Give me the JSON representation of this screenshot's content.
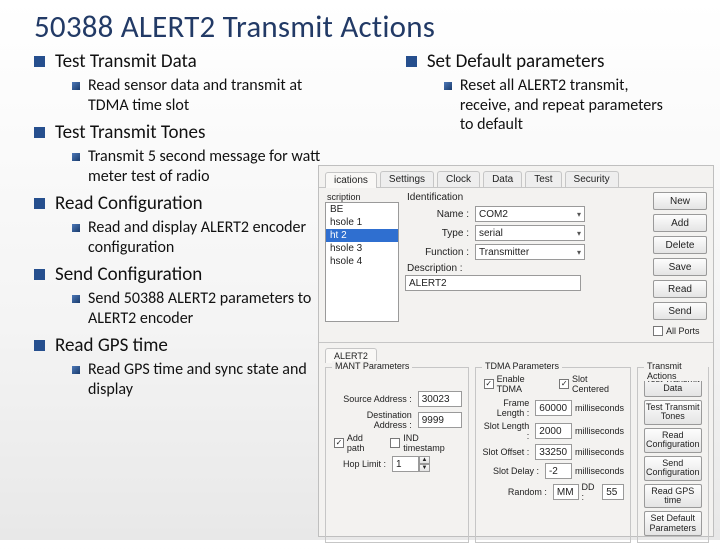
{
  "title": "50388 ALERT2 Transmit Actions",
  "left": [
    {
      "label": "Test Transmit Data",
      "sub": [
        "Read sensor data and transmit at TDMA time slot"
      ]
    },
    {
      "label": "Test Transmit Tones",
      "sub": [
        "Transmit 5 second message for watt meter test of radio"
      ]
    },
    {
      "label": "Read Configuration",
      "sub": [
        "Read and display ALERT2 encoder configuration"
      ]
    },
    {
      "label": "Send Configuration",
      "sub": [
        "Send 50388 ALERT2 parameters to ALERT2 encoder"
      ]
    },
    {
      "label": "Read GPS time",
      "sub": [
        "Read GPS time and sync state and display"
      ]
    }
  ],
  "right": [
    {
      "label": "Set Default parameters",
      "sub": [
        "Reset all ALERT2 transmit, receive, and repeat parameters to default"
      ]
    }
  ],
  "shot": {
    "tabs": [
      "ications",
      "Settings",
      "Clock",
      "Data",
      "Test",
      "Security"
    ],
    "active_tab": 0,
    "list_header": "scription",
    "list_items": [
      "BE",
      "hsole 1",
      "ht 2",
      "hsole 3",
      "hsole 4"
    ],
    "list_selected": 2,
    "id_group": "Identification",
    "form": {
      "name_label": "Name :",
      "name_value": "COM2",
      "type_label": "Type :",
      "type_value": "serial",
      "func_label": "Function :",
      "func_value": "Transmitter",
      "desc_label": "Description :",
      "desc_value": "ALERT2"
    },
    "buttons": [
      "New",
      "Add",
      "Delete",
      "Save",
      "Read",
      "Send"
    ],
    "allports_label": "All Ports",
    "lower_tab": "ALERT2",
    "g1": {
      "caption": "MANT Parameters",
      "src_label": "Source Address :",
      "src_value": "30023",
      "dst_label": "Destination Address :",
      "dst_value": "9999",
      "addpath_label": "Add path",
      "indts_label": "IND timestamp",
      "hop_label": "Hop Limit :",
      "hop_value": "1"
    },
    "g2": {
      "caption": "TDMA Parameters",
      "enable_label": "Enable TDMA",
      "centered_label": "Slot Centered",
      "frame_label": "Frame Length :",
      "frame_value": "60000",
      "slotlen_label": "Slot Length :",
      "slotlen_value": "2000",
      "slotoff_label": "Slot Offset :",
      "slotoff_value": "33250",
      "slotdly_label": "Slot Delay :",
      "slotdly_value": "-2",
      "rnd_label": "Random :",
      "rnd_value": "MM",
      "rnd_unit_label": "DD :",
      "rnd_unit_value": "55",
      "unit_ms": "milliseconds"
    },
    "g3": {
      "caption": "Transmit Actions",
      "buttons": [
        "Test Transmit Data",
        "Test Transmit Tones",
        "Read Configuration",
        "Send Configuration",
        "Read GPS time",
        "Set Default Parameters"
      ]
    }
  }
}
